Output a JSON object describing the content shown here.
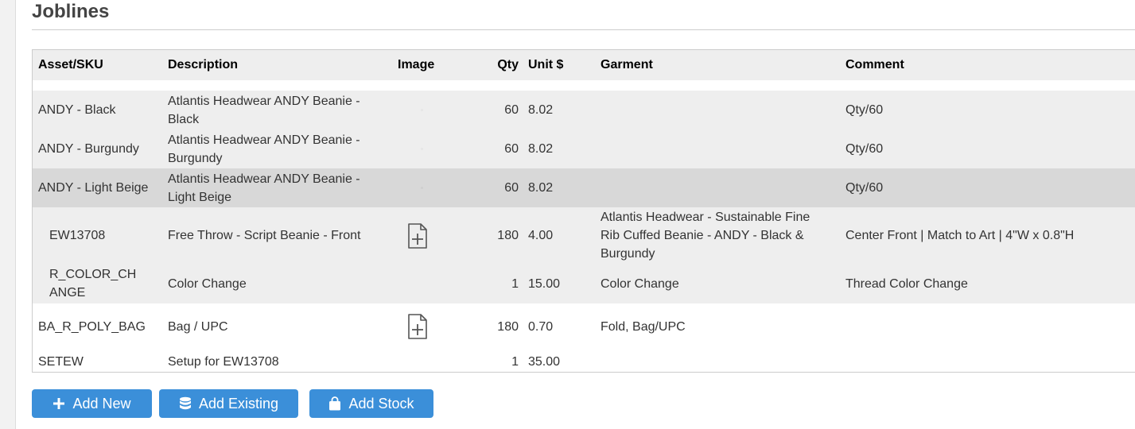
{
  "section": {
    "title": "Joblines"
  },
  "table": {
    "headers": {
      "asset": "Asset/SKU",
      "description": "Description",
      "image": "Image",
      "qty": "Qty",
      "unit": "Unit $",
      "garment": "Garment",
      "comment": "Comment"
    },
    "rows": [
      {
        "asset": "ANDY - Black",
        "description": "Atlantis Headwear ANDY Beanie - Black",
        "qty": "60",
        "unit": "8.02",
        "garment": "",
        "comment": "Qty/60"
      },
      {
        "asset": "ANDY - Burgundy",
        "description": "Atlantis Headwear ANDY Beanie - Burgundy",
        "qty": "60",
        "unit": "8.02",
        "garment": "",
        "comment": "Qty/60"
      },
      {
        "asset": "ANDY - Light Beige",
        "description": "Atlantis Headwear ANDY Beanie - Light Beige",
        "qty": "60",
        "unit": "8.02",
        "garment": "",
        "comment": "Qty/60"
      },
      {
        "asset": "EW13708",
        "description": "Free Throw - Script Beanie - Front",
        "qty": "180",
        "unit": "4.00",
        "garment": "Atlantis Headwear - Sustainable Fine Rib Cuffed Beanie - ANDY - Black & Burgundy",
        "comment": "Center Front | Match to Art | 4\"W x 0.8\"H"
      },
      {
        "asset": "R_COLOR_CHANGE",
        "description": "Color Change",
        "qty": "1",
        "unit": "15.00",
        "garment": "Color Change",
        "comment": "Thread Color Change"
      },
      {
        "asset": "BA_R_POLY_BAG",
        "description": "Bag / UPC",
        "qty": "180",
        "unit": "0.70",
        "garment": "Fold, Bag/UPC",
        "comment": ""
      },
      {
        "asset": "SETEW",
        "description": "Setup for EW13708",
        "qty": "1",
        "unit": "35.00",
        "garment": "",
        "comment": ""
      }
    ]
  },
  "icons": {
    "file_add": "file-plus-icon",
    "plus": "plus-icon",
    "database": "database-icon",
    "bag": "shopping-bag-icon"
  },
  "actions": {
    "add_new": "Add New",
    "add_existing": "Add Existing",
    "add_stock": "Add Stock"
  },
  "colors": {
    "button": "#3b8fd9",
    "header_bg": "#eeeeee",
    "selected_row": "#d8d8d8"
  }
}
